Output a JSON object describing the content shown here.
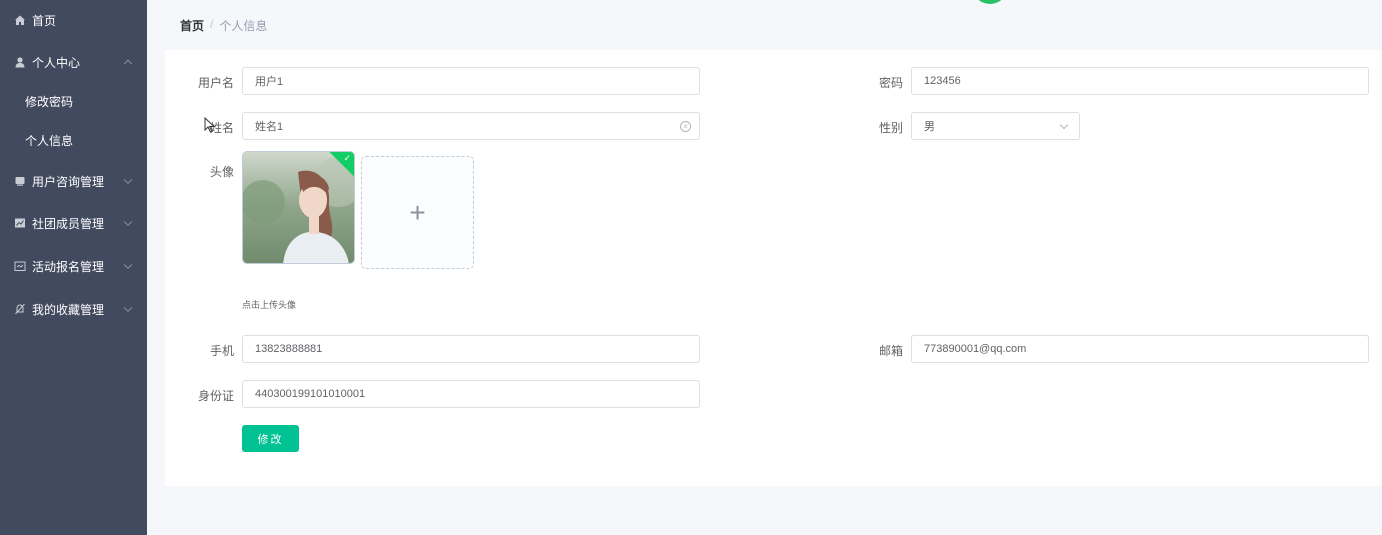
{
  "sidebar": {
    "items": [
      {
        "label": "首页",
        "icon": "home-icon"
      },
      {
        "label": "个人中心",
        "icon": "user-icon",
        "expanded": true
      },
      {
        "label": "修改密码"
      },
      {
        "label": "个人信息"
      },
      {
        "label": "用户咨询管理",
        "icon": "folder-icon"
      },
      {
        "label": "社团成员管理",
        "icon": "chart-icon"
      },
      {
        "label": "活动报名管理",
        "icon": "calendar-icon"
      },
      {
        "label": "我的收藏管理",
        "icon": "bell-icon"
      }
    ]
  },
  "breadcrumb": {
    "home": "首页",
    "separator": "/",
    "current": "个人信息"
  },
  "form": {
    "username_label": "用户名",
    "username_value": "用户1",
    "password_label": "密码",
    "password_value": "123456",
    "name_label": "姓名",
    "name_value": "姓名1",
    "gender_label": "性别",
    "gender_value": "男",
    "avatar_label": "头像",
    "upload_hint": "点击上传头像",
    "upload_plus": "+",
    "phone_label": "手机",
    "phone_value": "13823888881",
    "email_label": "邮箱",
    "email_value": "773890001@qq.com",
    "idcard_label": "身份证",
    "idcard_value": "440300199101010001",
    "submit_label": "修改"
  },
  "colors": {
    "sidebar_bg": "#414a5e",
    "accent": "#00c292",
    "page_bg": "#f5f7fa"
  }
}
